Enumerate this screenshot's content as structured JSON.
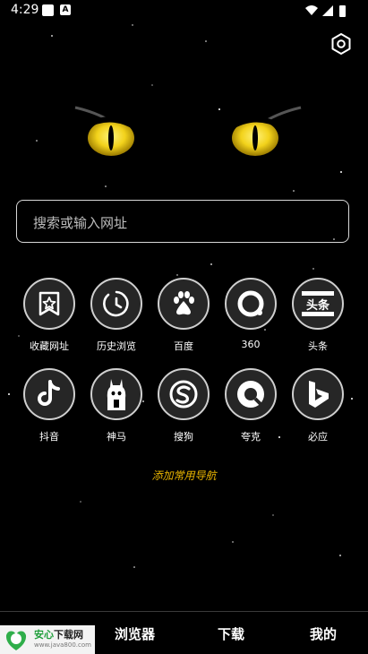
{
  "status_bar": {
    "time": "4:29",
    "a_icon": "A"
  },
  "search": {
    "placeholder": "搜索或输入网址"
  },
  "shortcuts": [
    {
      "label": "收藏网址",
      "icon": "bookmark-star-icon"
    },
    {
      "label": "历史浏览",
      "icon": "history-clock-icon"
    },
    {
      "label": "百度",
      "icon": "baidu-paw-icon"
    },
    {
      "label": "360",
      "icon": "360-ring-icon"
    },
    {
      "label": "头条",
      "icon": "toutiao-icon",
      "icon_text": "头条"
    },
    {
      "label": "抖音",
      "icon": "douyin-note-icon"
    },
    {
      "label": "神马",
      "icon": "shenma-alpaca-icon"
    },
    {
      "label": "搜狗",
      "icon": "sogou-s-icon"
    },
    {
      "label": "夸克",
      "icon": "quark-icon"
    },
    {
      "label": "必应",
      "icon": "bing-icon"
    }
  ],
  "add_nav": "添加常用导航",
  "watermark": {
    "title_a": "安心",
    "title_b": "下载网",
    "url": "www.java800.com",
    "logo_text": "安心\n免费"
  },
  "bottom_nav": {
    "browser": "浏览器",
    "download": "下载",
    "mine": "我的"
  },
  "colors": {
    "accent": "#e8b400",
    "eye": "#f2d21b",
    "background": "#000000"
  }
}
